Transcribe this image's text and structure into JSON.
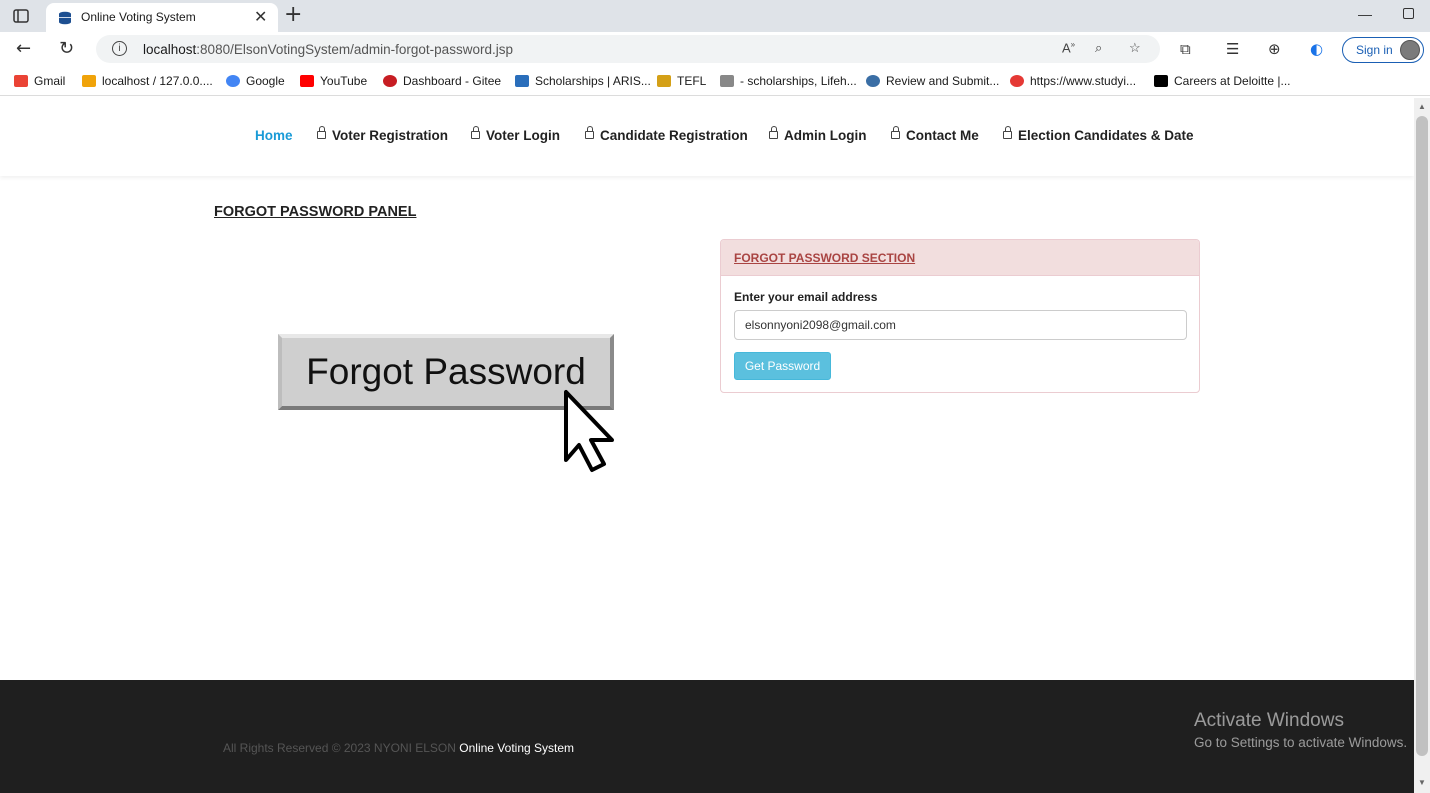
{
  "browser": {
    "tab_title": "Online Voting System",
    "url_host": "localhost",
    "url_rest": ":8080/ElsonVotingSystem/admin-forgot-password.jsp",
    "signin_label": "Sign in",
    "bookmarks": [
      {
        "label": "Gmail",
        "color": "#ea4335"
      },
      {
        "label": "localhost / 127.0.0....",
        "color": "#f0a30a"
      },
      {
        "label": "Google",
        "color": "#4285f4"
      },
      {
        "label": "YouTube",
        "color": "#ff0000"
      },
      {
        "label": "Dashboard - Gitee",
        "color": "#c71d23"
      },
      {
        "label": "Scholarships | ARIS...",
        "color": "#2a6ebb"
      },
      {
        "label": "TEFL",
        "color": "#d4a017"
      },
      {
        "label": "- scholarships, Lifeh...",
        "color": "#888888"
      },
      {
        "label": "Review and Submit...",
        "color": "#3a6ea5"
      },
      {
        "label": "https://www.studyi...",
        "color": "#e53935"
      },
      {
        "label": "Careers at Deloitte |...",
        "color": "#000000"
      }
    ]
  },
  "nav": {
    "home": "Home",
    "voter_registration": "Voter Registration",
    "voter_login": "Voter Login",
    "candidate_registration": "Candidate Registration",
    "admin_login": "Admin Login",
    "contact_me": "Contact Me",
    "election_candidates": "Election Candidates & Date"
  },
  "panel": {
    "title": "FORGOT PASSWORD PANEL",
    "illustration_text": "Forgot Password"
  },
  "card": {
    "header": "FORGOT PASSWORD SECTION",
    "label": "Enter your email address",
    "email_value": "elsonnyoni2098@gmail.com",
    "button": "Get Password"
  },
  "footer": {
    "copyright": "All Rights Reserved  © 2023 NYONI ELSON",
    "brand": "Online Voting System"
  },
  "watermark": {
    "line1": "Activate Windows",
    "line2": "Go to Settings to activate Windows."
  },
  "colors": {
    "accent": "#1a9bd7",
    "panel_header_bg": "#f2dede",
    "panel_header_text": "#a94442",
    "button_bg": "#5bc0de",
    "footer_bg": "#1f1f1f"
  }
}
